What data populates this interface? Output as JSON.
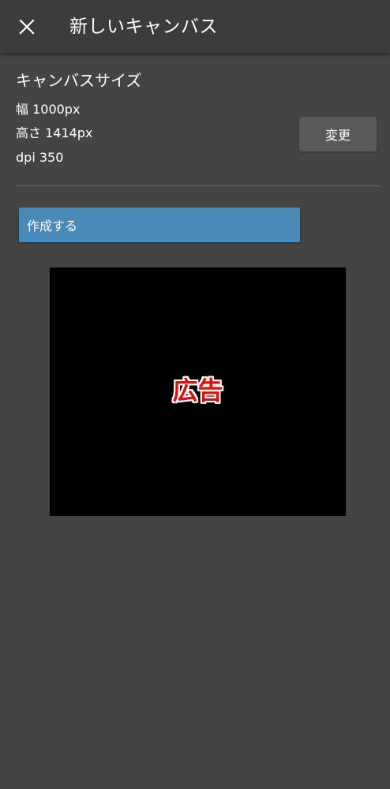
{
  "header": {
    "title": "新しいキャンバス",
    "close_icon": "close-icon"
  },
  "canvas_size": {
    "section_title": "キャンバスサイズ",
    "width_text": "幅 1000px",
    "height_text": "高さ 1414px",
    "dpi_text": "dpi 350",
    "change_label": "変更"
  },
  "actions": {
    "create_label": "作成する"
  },
  "ad": {
    "label": "広告"
  },
  "colors": {
    "background": "#444444",
    "appbar": "#3c3c3c",
    "primary_button": "#4a8ab8",
    "secondary_button": "#5a5a5a",
    "ad_label": "#e01010"
  }
}
